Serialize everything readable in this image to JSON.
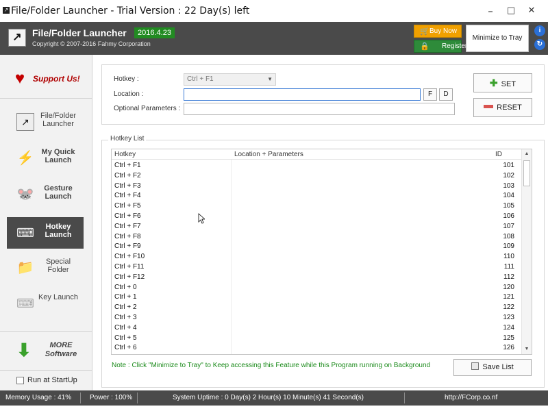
{
  "window": {
    "title": "File/Folder Launcher - Trial Version : 22 Day(s) left",
    "controls": {
      "minimize": "–",
      "maximize": "□",
      "close": "✕"
    }
  },
  "header": {
    "app_name": "File/Folder Launcher",
    "version": "2016.4.23",
    "copyright": "Copyright © 2007-2016 Fahmy Corporation",
    "buy_now": "Buy Now",
    "register": "Register",
    "minimize_to_tray": "Minimize to Tray",
    "info_icon": "i",
    "refresh_icon": "↻"
  },
  "sidebar": {
    "support": "Support Us!",
    "items": [
      {
        "label": "File/Folder Launcher",
        "icon": "shortcut-icon"
      },
      {
        "label": "My Quick Launch",
        "icon": "lightning-icon"
      },
      {
        "label": "Gesture Launch",
        "icon": "mouse-icon"
      },
      {
        "label": "Hotkey Launch",
        "icon": "keyboard-icon"
      },
      {
        "label": "Special Folder",
        "icon": "folder-icon"
      },
      {
        "label": "Key Launch",
        "icon": "keys-icon"
      }
    ],
    "more_software": "MORE Software",
    "run_at_startup": "Run at StartUp"
  },
  "form": {
    "hotkey_label": "Hotkey :",
    "hotkey_value": "Ctrl + F1",
    "location_label": "Location :",
    "location_value": "",
    "params_label": "Optional Parameters :",
    "params_value": "",
    "file_button": "F",
    "dir_button": "D",
    "set_button": "SET",
    "reset_button": "RESET"
  },
  "hotkey_list": {
    "title": "Hotkey List",
    "columns": [
      "Hotkey",
      "Location + Parameters",
      "ID"
    ],
    "rows": [
      {
        "hotkey": "Ctrl + F1",
        "location": "",
        "id": "101"
      },
      {
        "hotkey": "Ctrl + F2",
        "location": "",
        "id": "102"
      },
      {
        "hotkey": "Ctrl + F3",
        "location": "",
        "id": "103"
      },
      {
        "hotkey": "Ctrl + F4",
        "location": "",
        "id": "104"
      },
      {
        "hotkey": "Ctrl + F5",
        "location": "",
        "id": "105"
      },
      {
        "hotkey": "Ctrl + F6",
        "location": "",
        "id": "106"
      },
      {
        "hotkey": "Ctrl + F7",
        "location": "",
        "id": "107"
      },
      {
        "hotkey": "Ctrl + F8",
        "location": "",
        "id": "108"
      },
      {
        "hotkey": "Ctrl + F9",
        "location": "",
        "id": "109"
      },
      {
        "hotkey": "Ctrl + F10",
        "location": "",
        "id": "110"
      },
      {
        "hotkey": "Ctrl + F11",
        "location": "",
        "id": "111"
      },
      {
        "hotkey": "Ctrl + F12",
        "location": "",
        "id": "112"
      },
      {
        "hotkey": "Ctrl + 0",
        "location": "",
        "id": "120"
      },
      {
        "hotkey": "Ctrl + 1",
        "location": "",
        "id": "121"
      },
      {
        "hotkey": "Ctrl + 2",
        "location": "",
        "id": "122"
      },
      {
        "hotkey": "Ctrl + 3",
        "location": "",
        "id": "123"
      },
      {
        "hotkey": "Ctrl + 4",
        "location": "",
        "id": "124"
      },
      {
        "hotkey": "Ctrl + 5",
        "location": "",
        "id": "125"
      },
      {
        "hotkey": "Ctrl + 6",
        "location": "",
        "id": "126"
      }
    ],
    "scroll_up": "▲",
    "scroll_down": "▼"
  },
  "note": "Note : Click \"Minimize to Tray\" to Keep accessing this Feature while this Program running on Background",
  "save_list": "Save List",
  "status": {
    "memory": "Memory Usage : 41%",
    "power": "Power : 100%",
    "uptime": "System Uptime : 0 Day(s) 2 Hour(s) 10 Minute(s) 41 Second(s)",
    "website": "http://FCorp.co.nf"
  },
  "colors": {
    "header_bg": "#4a4a4a",
    "version_badge": "#228b22",
    "buy_now": "#f0a000",
    "register": "#2e8b3a",
    "note_text": "#1a8a1a",
    "support_text": "#b00000"
  }
}
